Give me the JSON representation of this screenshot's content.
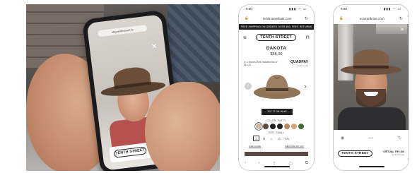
{
  "photo": {
    "url": "nbg.tenthstreet.fs",
    "close_glyph": "✕",
    "brand_logo": "TENTH STREET"
  },
  "product_page": {
    "status_time": "9:00",
    "status_icons": "▮▮▮ ◠ ▭",
    "url": "tenthstreethats.com",
    "shipping_banner": "FREE SHIPPING ON ORDERS OVER $50, FREE RETURNS",
    "brand_logo": "TENTH STREET",
    "product_name": "DAKOTA",
    "price": "$56.00",
    "installments_text": "or 4 interest-free installments of $14.00",
    "quadpay": "QUADPAY",
    "learn_more": "Learn more",
    "prev_glyph": "‹",
    "next_glyph": "›",
    "try_on_button": "TRY IT ON IN AR",
    "color_label": "COLOR: PUTTY",
    "swatches": [
      "#cbb89a",
      "#5c4a3a",
      "#1f1f1f",
      "#222222",
      "#b9835b",
      "#d9a67a",
      "#4a6b3b"
    ],
    "size_label": "SIZE: SMALL",
    "sizes": [
      "S",
      "M",
      "L",
      "XL",
      "XXL"
    ],
    "size_guide": "SIZE GUIDE",
    "measure_guide": "MEASURE MY HAT",
    "bottom_nav": [
      "‹",
      "›",
      "⇪",
      "▢",
      "⧉"
    ]
  },
  "tryon_page": {
    "status_time": "9:00",
    "status_icons": "▮▮▮ ◠ ▭",
    "url": "at.virtelbrias.com",
    "close_glyph": "✕",
    "tools": [
      "◉",
      "▭",
      "↻"
    ],
    "brand_logo": "TENTH STREET",
    "vto_title": "VIRTUAL TRY-ON",
    "vto_by": "by Tenthstreet"
  }
}
